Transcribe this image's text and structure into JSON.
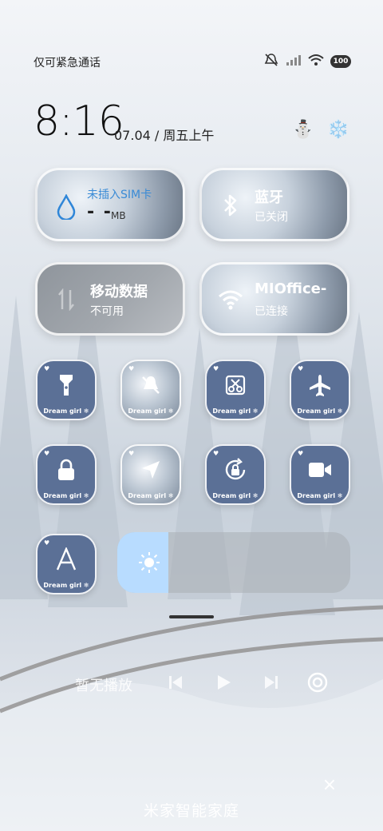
{
  "status": {
    "carrier": "仅可紧急通话",
    "icons": [
      "mute-icon",
      "signal-icon",
      "wifi-icon",
      "battery-icon"
    ],
    "battery_text": "100"
  },
  "clock": {
    "time": "8:16",
    "date": "07.04 / 周五上午"
  },
  "top_icons": [
    "snowman-icon",
    "snowflake-icon"
  ],
  "tiles": {
    "sim": {
      "title": "未插入SIM卡",
      "value": "- -",
      "unit": "MB"
    },
    "bluetooth": {
      "title": "蓝牙",
      "status": "已关闭"
    },
    "mobile_data": {
      "title": "移动数据",
      "status": "不可用"
    },
    "wifi": {
      "title": "MIOffice-",
      "status": "已连接"
    }
  },
  "small_tiles": [
    {
      "icon": "flashlight-icon",
      "label": "Dream girl ❄"
    },
    {
      "icon": "silent-bell-icon",
      "label": "Dream girl ❄"
    },
    {
      "icon": "screenshot-icon",
      "label": "Dream girl ❄"
    },
    {
      "icon": "airplane-icon",
      "label": "Dream girl ❄"
    },
    {
      "icon": "lock-icon",
      "label": "Dream girl ❄"
    },
    {
      "icon": "location-icon",
      "label": "Dream girl ❄"
    },
    {
      "icon": "rotation-lock-icon",
      "label": "Dream girl ❄"
    },
    {
      "icon": "video-icon",
      "label": "Dream girl ❄"
    },
    {
      "icon": "font-icon",
      "label": "Dream girl ❄"
    }
  ],
  "brightness": {
    "level": 0.22
  },
  "media": {
    "text": "暂无播放",
    "buttons": [
      "previous-icon",
      "play-icon",
      "next-icon",
      "cast-icon"
    ]
  },
  "footer": {
    "title": "米家智能家庭",
    "close": "×"
  },
  "colors": {
    "tile_blue": "#5b7096",
    "accent_blue": "#3a8bd6",
    "slider_fill": "#b8dcff"
  }
}
